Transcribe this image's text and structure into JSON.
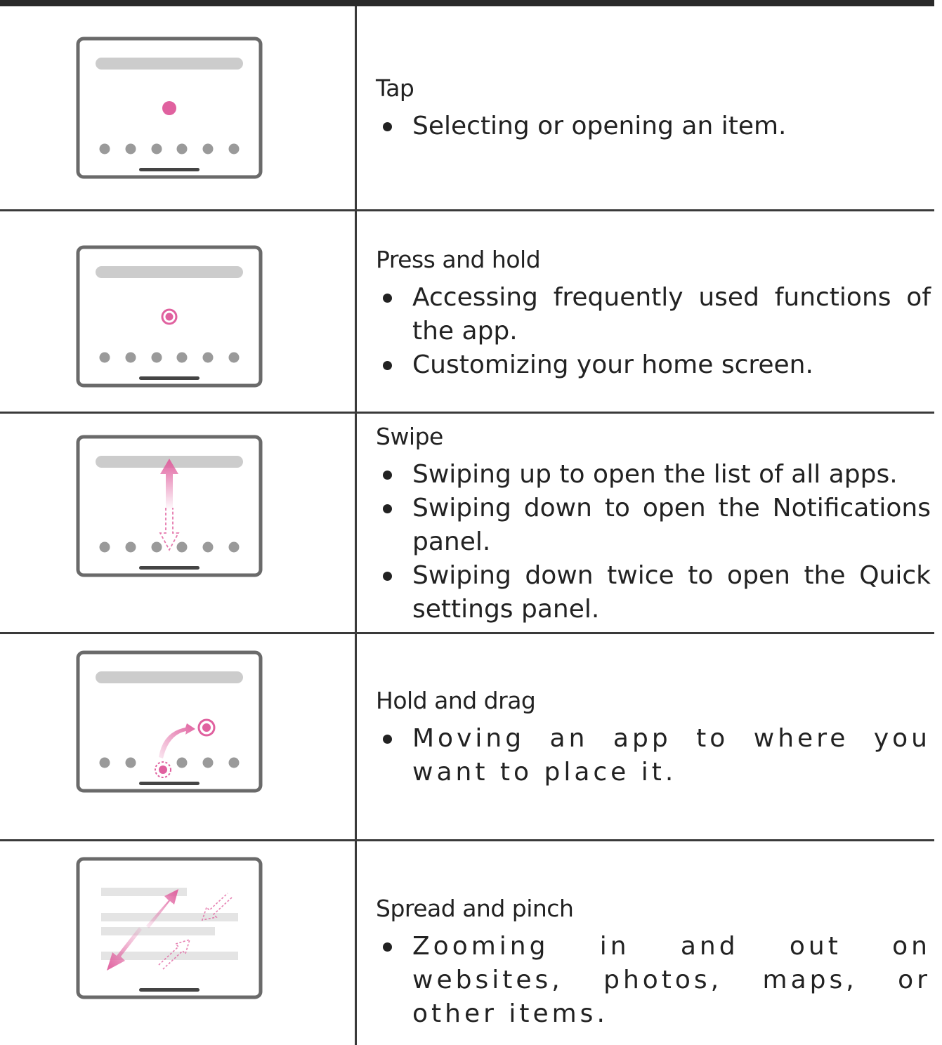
{
  "rows": [
    {
      "title": "Tap",
      "bullets": [
        "Selecting or opening an item."
      ]
    },
    {
      "title": "Press and hold",
      "bullets": [
        "Accessing frequently used functions of the app.",
        "Customizing your home screen."
      ]
    },
    {
      "title": "Swipe",
      "bullets": [
        "Swiping up to open the list of all apps.",
        "Swiping down to open the Notifications panel.",
        "Swiping down twice to open the Quick settings panel."
      ]
    },
    {
      "title": "Hold and drag",
      "bullets": [
        "Moving an app to where you want to place it."
      ]
    },
    {
      "title": "Spread and pinch",
      "bullets": [
        "Zooming in and out on websites, photos, maps, or other items."
      ]
    }
  ],
  "colors": {
    "accent": "#e0619f",
    "frame": "#6a6a6a",
    "placeholder": "#cccccc",
    "dock_dot": "#9a9a9a",
    "rule": "#3a3a3a"
  },
  "icons": [
    "tap-gesture-icon",
    "press-hold-gesture-icon",
    "swipe-gesture-icon",
    "hold-drag-gesture-icon",
    "spread-pinch-gesture-icon"
  ]
}
